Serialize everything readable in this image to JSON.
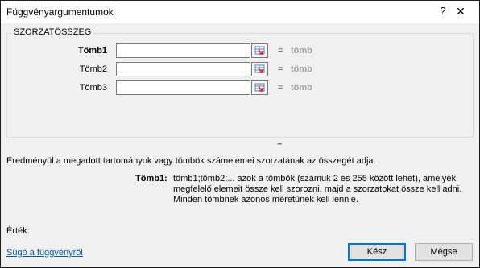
{
  "window": {
    "title": "Függvényargumentumok",
    "help_glyph": "?",
    "close_glyph": "✕"
  },
  "function": {
    "name": "SZORZATÖSSZEG",
    "arguments": [
      {
        "label": "Tömb1",
        "bold": true,
        "value": "",
        "equals": "=",
        "hint": "tömb"
      },
      {
        "label": "Tömb2",
        "bold": false,
        "value": "",
        "equals": "=",
        "hint": "tömb"
      },
      {
        "label": "Tömb3",
        "bold": false,
        "value": "",
        "equals": "=",
        "hint": "tömb"
      }
    ],
    "result_equals": "=",
    "description": "Eredményül a megadott tartományok vagy tömbök számelemei szorzatának az összegét adja.",
    "argument_description": {
      "label": "Tömb1:",
      "lines": [
        "tömb1;tömb2;... azok a tömbök (számuk 2 és 255 között lehet), amelyek",
        "megfelelő elemeit össze kell szorozni, majd a szorzatokat össze kell adni.",
        "Minden tömbnek azonos méretűnek kell lennie."
      ]
    }
  },
  "footer": {
    "value_label": "Érték:",
    "help_link": "Súgó a függvényről",
    "ok_label": "Kész",
    "cancel_label": "Mégse"
  },
  "icons": {
    "ref": "range-select-icon"
  },
  "colors": {
    "link": "#0b5ba8",
    "default_button_border": "#0078d7",
    "hint_text": "#a0a0a0"
  }
}
